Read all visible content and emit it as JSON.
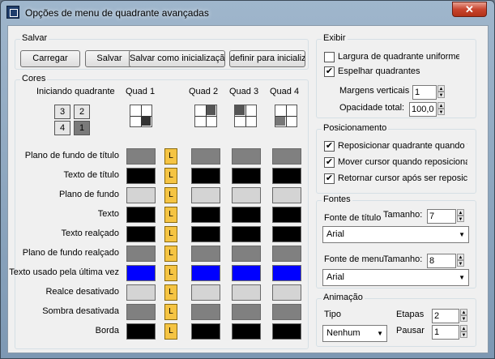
{
  "window": {
    "title": "Opções de menu de quadrante avançadas",
    "close_glyph": "✕"
  },
  "salvar": {
    "label": "Salvar",
    "buttons": [
      "Carregar",
      "Salvar",
      "Salvar como inicialização",
      "definir para inicialização"
    ]
  },
  "cores": {
    "label": "Cores",
    "iniciando": "Iniciando quadrante",
    "quad_selector": [
      "3",
      "2",
      "4",
      "1"
    ],
    "quad_headers": [
      "Quad 1",
      "Quad 2",
      "Quad 3",
      "Quad 4"
    ],
    "rows": [
      {
        "label": "Plano de fundo de título",
        "colors": [
          "#808080",
          "#808080",
          "#808080",
          "#808080"
        ]
      },
      {
        "label": "Texto de título",
        "colors": [
          "#000000",
          "#000000",
          "#000000",
          "#000000"
        ]
      },
      {
        "label": "Plano de fundo",
        "colors": [
          "#d4d4d4",
          "#d4d4d4",
          "#d4d4d4",
          "#d4d4d4"
        ]
      },
      {
        "label": "Texto",
        "colors": [
          "#000000",
          "#000000",
          "#000000",
          "#000000"
        ]
      },
      {
        "label": "Texto realçado",
        "colors": [
          "#000000",
          "#000000",
          "#000000",
          "#000000"
        ]
      },
      {
        "label": "Plano de fundo realçado",
        "colors": [
          "#808080",
          "#808080",
          "#808080",
          "#808080"
        ]
      },
      {
        "label": "Texto usado pela última vez",
        "colors": [
          "#0000ff",
          "#0000ff",
          "#0000ff",
          "#0000ff"
        ]
      },
      {
        "label": "Realce desativado",
        "colors": [
          "#d4d4d4",
          "#d4d4d4",
          "#d4d4d4",
          "#d4d4d4"
        ]
      },
      {
        "label": "Sombra desativada",
        "colors": [
          "#808080",
          "#808080",
          "#808080",
          "#808080"
        ]
      },
      {
        "label": "Borda",
        "colors": [
          "#000000",
          "#000000",
          "#000000",
          "#000000"
        ]
      }
    ],
    "lock_label": "L"
  },
  "exibir": {
    "label": "Exibir",
    "largura": {
      "label": "Largura de quadrante uniforme",
      "checked": false
    },
    "espelhar": {
      "label": "Espelhar quadrantes",
      "checked": true
    },
    "margens_label": "Margens verticais",
    "margens_value": "1",
    "opacidade_label": "Opacidade total:",
    "opacidade_value": "100,0"
  },
  "posicionamento": {
    "label": "Posicionamento",
    "options": [
      {
        "label": "Reposicionar quadrante quando fora da tela",
        "checked": true
      },
      {
        "label": "Mover cursor quando reposicionado",
        "checked": true
      },
      {
        "label": "Retornar cursor após ser reposicionado",
        "checked": true
      }
    ]
  },
  "fontes": {
    "label": "Fontes",
    "titulo_label": "Fonte de título",
    "tamanho_label": "Tamanho:",
    "titulo_size": "7",
    "titulo_font": "Arial",
    "menu_label": "Fonte de menu",
    "menu_size": "8",
    "menu_font": "Arial"
  },
  "animacao": {
    "label": "Animação",
    "tipo_label": "Tipo",
    "tipo_value": "Nenhum",
    "etapas_label": "Etapas",
    "etapas_value": "2",
    "pausar_label": "Pausar",
    "pausar_value": "1"
  },
  "glyphs": {
    "check": "✔",
    "up": "▲",
    "down": "▼"
  }
}
